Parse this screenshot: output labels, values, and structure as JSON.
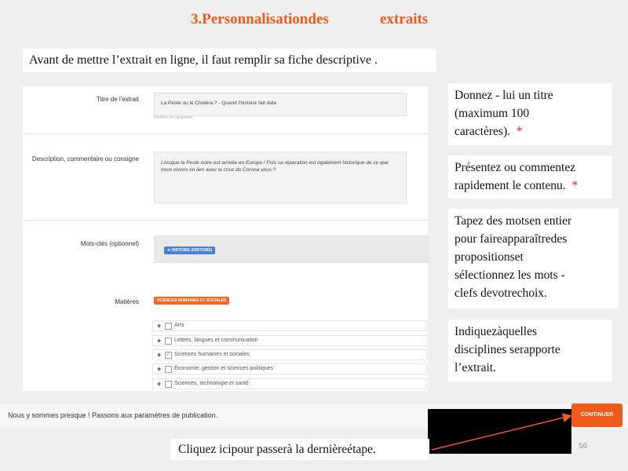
{
  "heading": {
    "part1": "3.Personnalisationdes",
    "part2": "extraits"
  },
  "intro": "Avant de mettre  l’extrait en ligne,  il faut  remplir  sa fiche descriptive  .",
  "form": {
    "title_label": "Titre de l'extrait",
    "title_value": "La Peste ou le Choléra ? - Quand l'histoire fait date",
    "title_hint": "Nombre de caractères",
    "description_label": "Description, commentaire ou consigne",
    "description_value": "Lorsque la Peste noire est arrivée en Europe / Puis sa réparation est également historique de ce que nous vivons en lien avec la crise du Corona virus ?",
    "keywords_label": "Mots-clés (optionnel)",
    "keyword_tag": "✕ HISTOIRE (HISTOIRE)",
    "subjects_label": "Matières",
    "subject_tag": "SCIENCES HUMAINES ET SOCIALES",
    "subjects": [
      {
        "label": "Arts",
        "checked": false
      },
      {
        "label": "Lettres, langues et communication",
        "checked": false
      },
      {
        "label": "Sciences humaines et sociales",
        "checked": true
      },
      {
        "label": "Économie, gestion et sciences politiques",
        "checked": false
      },
      {
        "label": "Sciences, technologie et santé",
        "checked": false
      }
    ]
  },
  "notes": {
    "n1_l1": "Donnez  - lui un  titre",
    "n1_l2": "(maximum    100",
    "n1_l3": "caractères).",
    "n2_l1": "Présentez    ou  commentez",
    "n2_l2": "rapidement    le contenu.",
    "n3_l1": "Tapez  des  motsen   entier",
    "n3_l2": "pour  faireapparaîtredes",
    "n3_l3": "propositionset",
    "n3_l4": "sélectionnez    les  mots  -",
    "n3_l5": "clefs  devotrechoix.",
    "n4_l1": "Indiquezàquelles",
    "n4_l2": "disciplines   serapporte",
    "n4_l3": "l’extrait.",
    "star": "*"
  },
  "footer": {
    "text": "Nous y sommes presque ! Passons aux paramètres de publication.",
    "continue": "CONTINUER"
  },
  "click_note": "Cliquez  icipour  passerà la    dernièreétape.",
  "page_number": "56",
  "colors": {
    "accent": "#f05a1a",
    "tag_blue": "#4a7fd8"
  }
}
